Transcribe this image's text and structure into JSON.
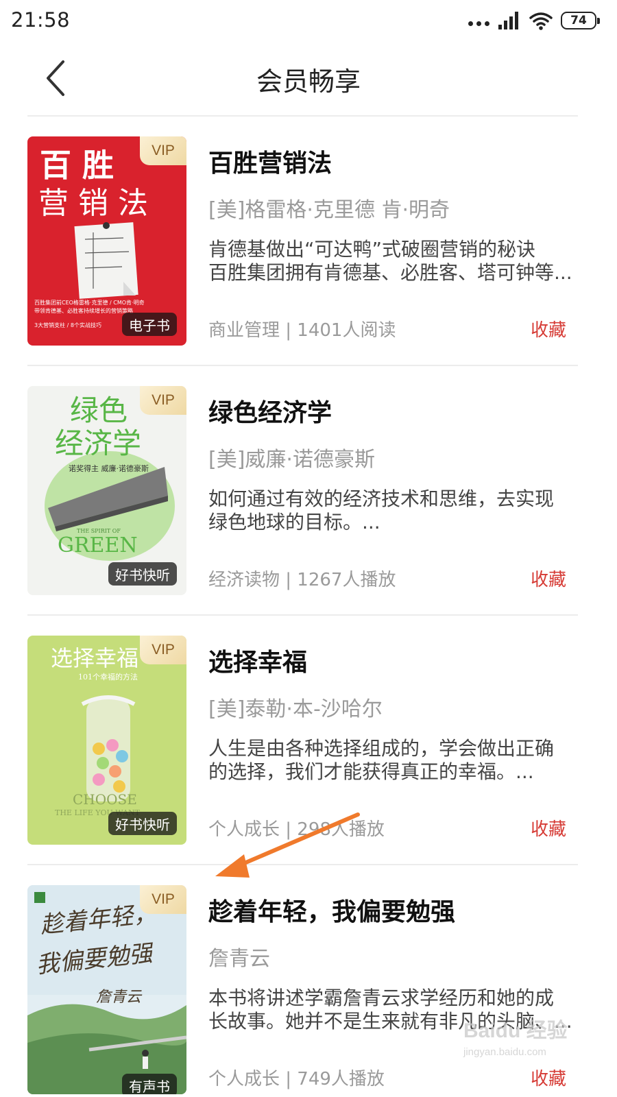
{
  "status_bar": {
    "time": "21:58",
    "battery": "74",
    "icons": [
      "more-dots-icon",
      "signal-icon",
      "wifi-icon",
      "battery-icon"
    ]
  },
  "nav": {
    "title": "会员畅享",
    "back_icon": "chevron-left-icon"
  },
  "books": [
    {
      "title": "百胜营销法",
      "author": "[美]格雷格·克里德 肯·明奇",
      "desc_line1": "肯德基做出“可达鸭”式破圈营销的秘诀",
      "desc_line2": "百胜集团拥有肯德基、必胜客、塔可钟等...",
      "meta": "商业管理 | 1401人阅读",
      "collect": "收藏",
      "vip": "VIP",
      "type_badge": "电子书",
      "cover": {
        "title_top": "百  胜",
        "title_bottom": "营 销 法",
        "caption1": "百胜集团前CEO格雷格·克里德 / CMO肯·明奇",
        "caption2": "带领肯德基、必胜客持续增长的营销策略",
        "caption3": "3大营销支柱 / 8个实战技巧"
      }
    },
    {
      "title": "绿色经济学",
      "author": "[美]威廉·诺德豪斯",
      "desc_line1": "如何通过有效的经济技术和思维，去实现",
      "desc_line2": "绿色地球的目标。...",
      "meta": "经济读物 | 1267人播放",
      "collect": "收藏",
      "vip": "VIP",
      "type_badge": "好书快听",
      "cover": {
        "title_top": "绿色",
        "title_bottom": "经济学",
        "author_line": "诺奖得主 威廉·诺德豪斯",
        "english_small": "THE SPIRIT OF",
        "english_big": "GREEN"
      }
    },
    {
      "title": "选择幸福",
      "author": "[美]泰勒·本-沙哈尔",
      "desc_line1": "人生是由各种选择组成的，学会做出正确",
      "desc_line2": "的选择，我们才能获得真正的幸福。...",
      "meta": "个人成长 | 298人播放",
      "collect": "收藏",
      "vip": "VIP",
      "type_badge": "好书快听",
      "cover": {
        "title_top": "选择幸福",
        "subtitle": "101个幸福的方法",
        "english1": "CHOOSE",
        "english2": "THE LIFE YOU WANT"
      }
    },
    {
      "title": "趁着年轻，我偏要勉强",
      "author": "詹青云",
      "desc_line1": "本书将讲述学霸詹青云求学经历和她的成",
      "desc_line2": "长故事。她并不是生来就有非凡的头脑、...",
      "meta": "个人成长 | 749人播放",
      "collect": "收藏",
      "vip": "VIP",
      "type_badge": "有声书",
      "cover": {
        "title_top": "趁着年轻，",
        "title_bottom": "我偏要勉强",
        "author_sig": "詹青云"
      }
    }
  ],
  "watermark": {
    "brand": "Baidu 经验",
    "url": "jingyan.baidu.com"
  },
  "colors": {
    "accent": "#d63b35",
    "annotation_arrow": "#f07a2c",
    "vip_gold": "#efd9a4"
  }
}
